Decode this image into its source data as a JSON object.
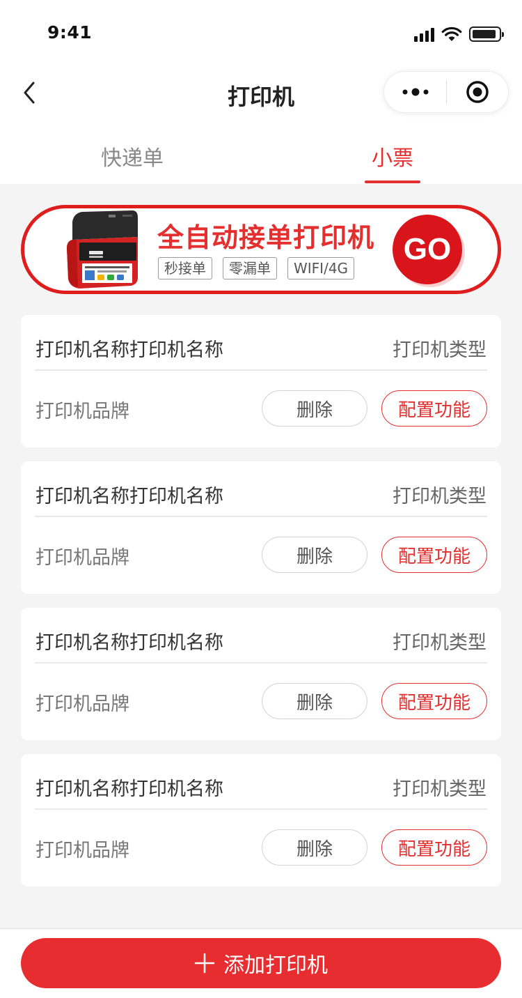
{
  "status_bar": {
    "time": "9:41"
  },
  "nav": {
    "title": "打印机"
  },
  "tabs": [
    {
      "label": "快递单",
      "active": false
    },
    {
      "label": "小票",
      "active": true
    }
  ],
  "banner": {
    "title": "全自动接单打印机",
    "tags": [
      "秒接单",
      "零漏单",
      "WIFI/4G"
    ],
    "go_label": "GO"
  },
  "printers": [
    {
      "name": "打印机名称打印机名称",
      "type": "打印机类型",
      "brand": "打印机品牌",
      "delete_label": "删除",
      "config_label": "配置功能"
    },
    {
      "name": "打印机名称打印机名称",
      "type": "打印机类型",
      "brand": "打印机品牌",
      "delete_label": "删除",
      "config_label": "配置功能"
    },
    {
      "name": "打印机名称打印机名称",
      "type": "打印机类型",
      "brand": "打印机品牌",
      "delete_label": "删除",
      "config_label": "配置功能"
    },
    {
      "name": "打印机名称打印机名称",
      "type": "打印机类型",
      "brand": "打印机品牌",
      "delete_label": "删除",
      "config_label": "配置功能"
    }
  ],
  "footer": {
    "add_label": "添加打印机"
  },
  "colors": {
    "accent": "#e52e2e",
    "background": "#f4f4f4",
    "card": "#ffffff"
  },
  "icons": {
    "back": "chevron-left-icon",
    "more": "more-dots-icon",
    "close": "target-circle-icon",
    "add": "plus-icon"
  }
}
